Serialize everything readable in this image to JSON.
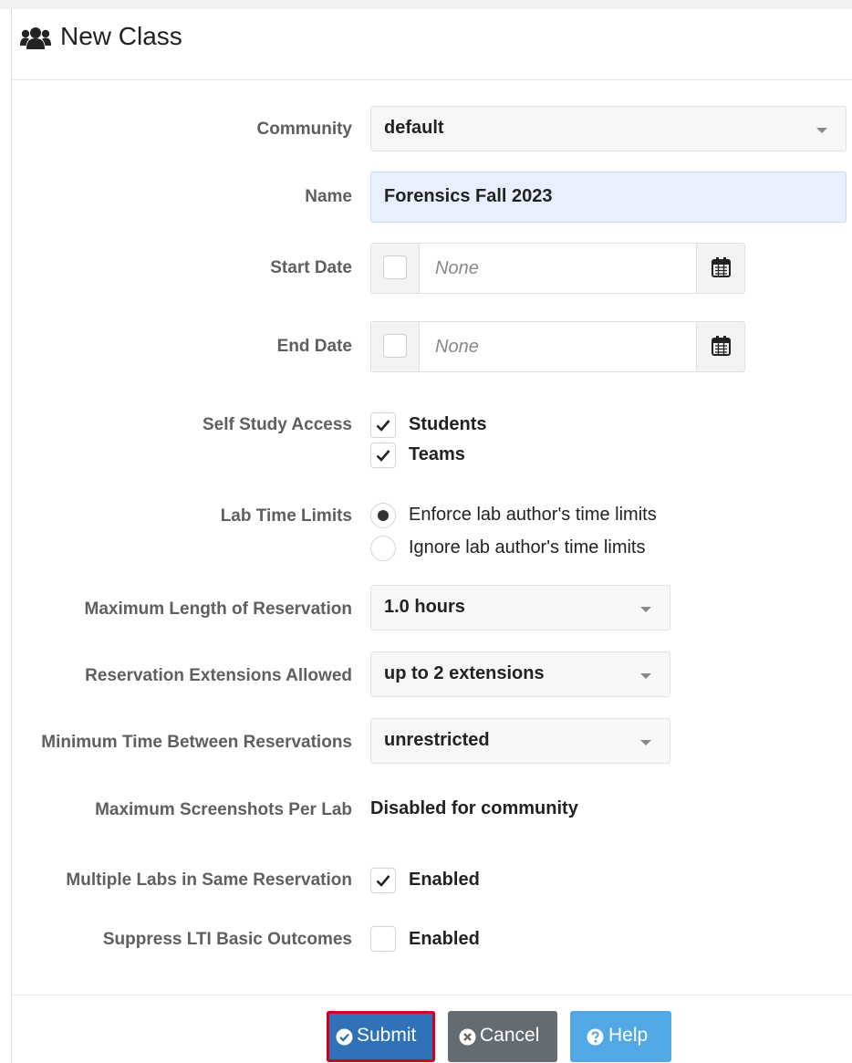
{
  "header": {
    "title": "New Class",
    "icon": "users-icon"
  },
  "form": {
    "community": {
      "label": "Community",
      "value": "default"
    },
    "name": {
      "label": "Name",
      "value": "Forensics Fall 2023"
    },
    "start_date": {
      "label": "Start Date",
      "placeholder": "None",
      "enabled": false
    },
    "end_date": {
      "label": "End Date",
      "placeholder": "None",
      "enabled": false
    },
    "self_study": {
      "label": "Self Study Access",
      "options": [
        {
          "label": "Students",
          "checked": true
        },
        {
          "label": "Teams",
          "checked": true
        }
      ]
    },
    "lab_time_limits": {
      "label": "Lab Time Limits",
      "options": [
        {
          "label": "Enforce lab author's time limits",
          "selected": true
        },
        {
          "label": "Ignore lab author's time limits",
          "selected": false
        }
      ]
    },
    "max_reservation": {
      "label": "Maximum Length of Reservation",
      "value": "1.0 hours"
    },
    "extensions": {
      "label": "Reservation Extensions Allowed",
      "value": "up to 2 extensions"
    },
    "min_between": {
      "label": "Minimum Time Between Reservations",
      "value": "unrestricted"
    },
    "max_screenshots": {
      "label": "Maximum Screenshots Per Lab",
      "value": "Disabled for community"
    },
    "multiple_labs": {
      "label": "Multiple Labs in Same Reservation",
      "option": "Enabled",
      "checked": true
    },
    "suppress_lti": {
      "label": "Suppress LTI Basic Outcomes",
      "option": "Enabled",
      "checked": false
    }
  },
  "buttons": {
    "submit": "Submit",
    "cancel": "Cancel",
    "help": "Help"
  },
  "colors": {
    "submit": "#2f72b8",
    "cancel": "#636b73",
    "help": "#52a8e4",
    "highlight": "#d0021b",
    "name_field_bg": "#e8f0fe"
  }
}
